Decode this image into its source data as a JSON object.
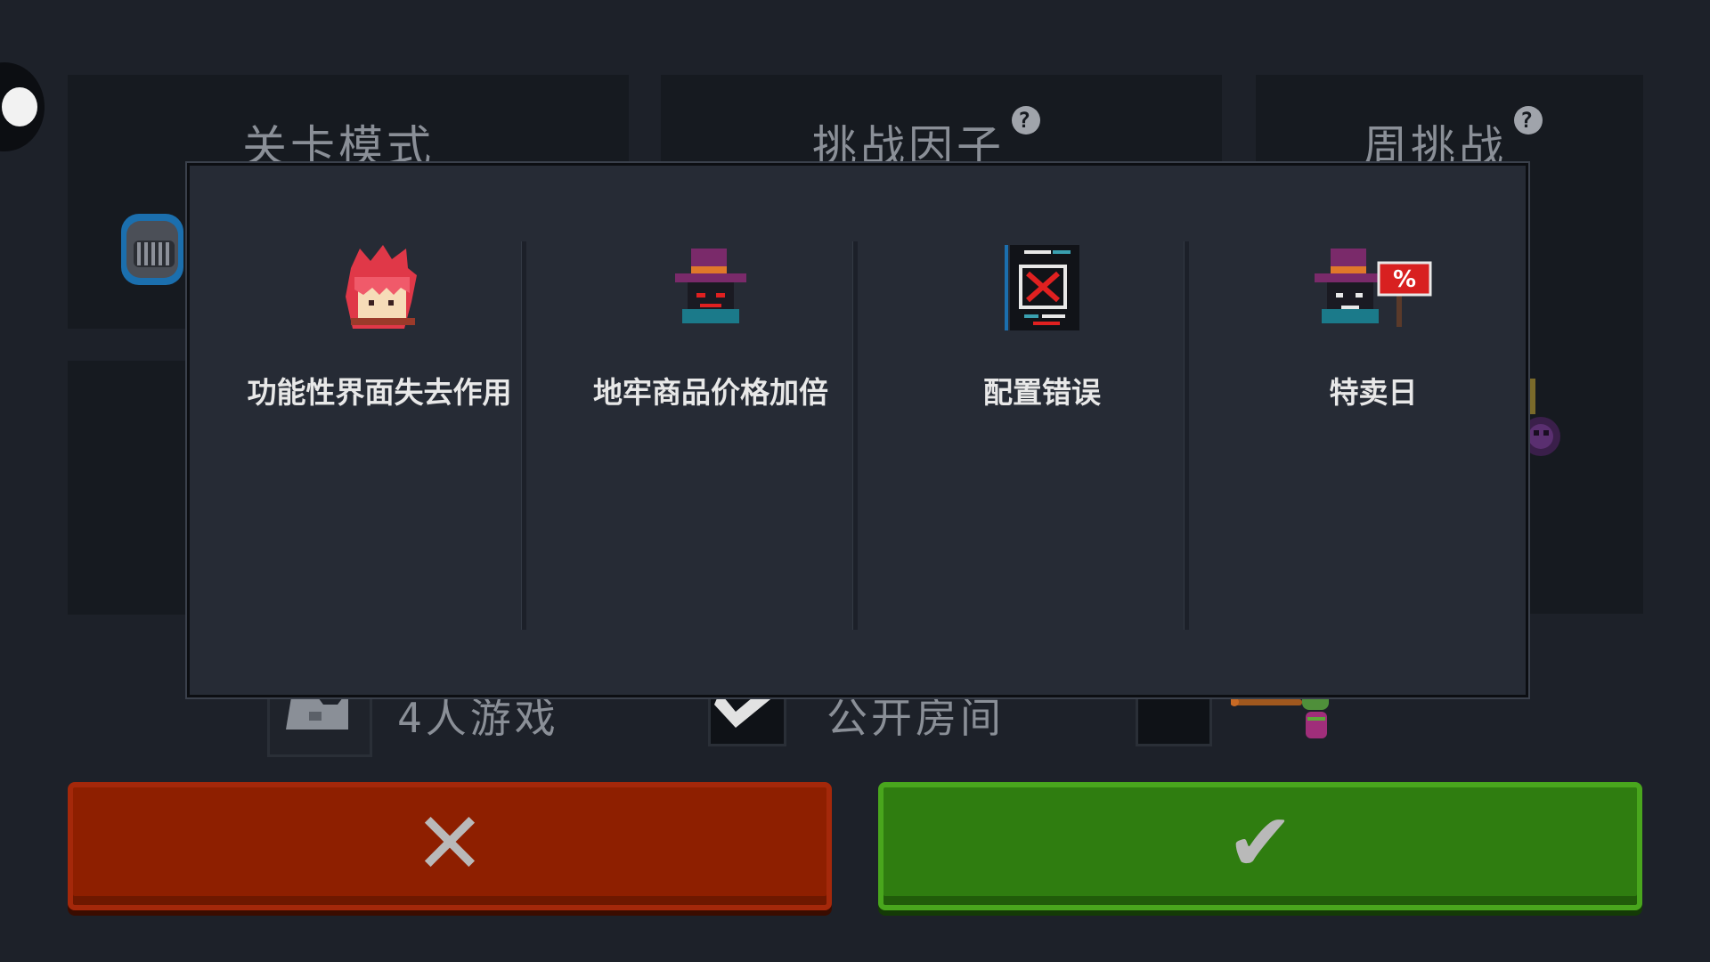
{
  "background": {
    "tabs": [
      {
        "label": "关卡模式",
        "help": false
      },
      {
        "label": "挑战因子",
        "help": true
      },
      {
        "label": "周挑战",
        "help": true
      }
    ],
    "help_glyph": "?",
    "options": {
      "players_label": "4人游戏",
      "public_room_label": "公开房间"
    }
  },
  "modal": {
    "cards": [
      {
        "icon": "red-hair-hero-icon",
        "label": "功能性界面失去作用"
      },
      {
        "icon": "purple-hat-merchant-angry-icon",
        "label": "地牢商品价格加倍"
      },
      {
        "icon": "config-error-screen-icon",
        "label": "配置错误"
      },
      {
        "icon": "merchant-sale-sign-icon",
        "label": "特卖日"
      }
    ]
  },
  "buttons": {
    "cancel_glyph": "✕",
    "confirm_glyph": "✔"
  },
  "colors": {
    "cancel": "#8e1f00",
    "confirm": "#2f7d10",
    "modal_bg": "#262b35",
    "page_bg": "#1d2129"
  }
}
